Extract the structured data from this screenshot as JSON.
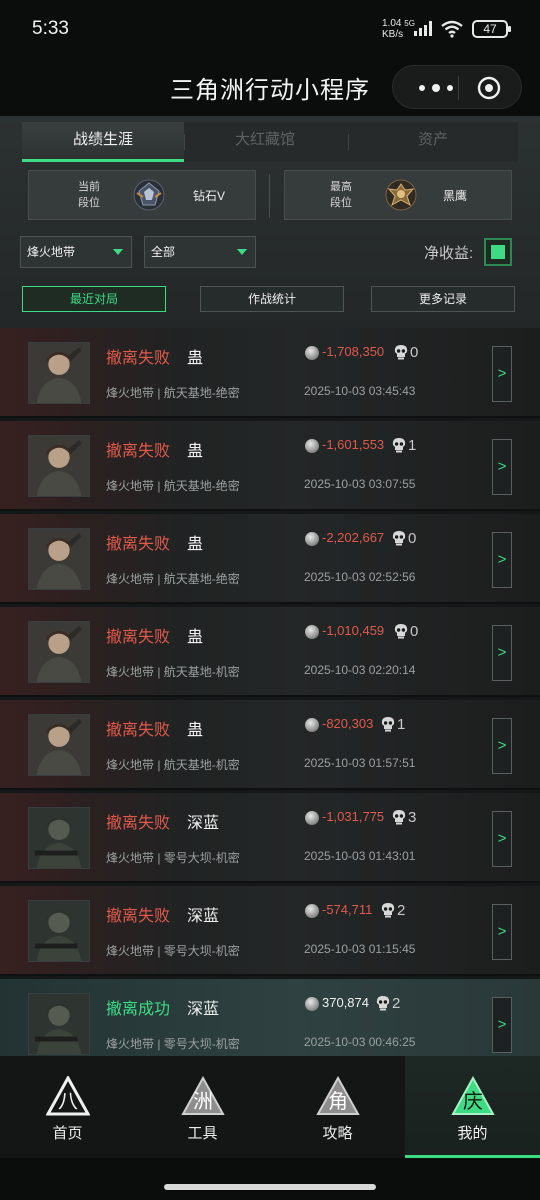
{
  "status_bar": {
    "time": "5:33",
    "net_speed": "1.04",
    "net_unit": "KB/s",
    "network": "5G",
    "battery": "47"
  },
  "app": {
    "title": "三角洲行动小程序"
  },
  "tabs": [
    {
      "label": "战绩生涯",
      "active": true
    },
    {
      "label": "大红藏馆",
      "active": false
    },
    {
      "label": "资产",
      "active": false
    }
  ],
  "rank": {
    "current_label_1": "当前",
    "current_label_2": "段位",
    "current_value": "钻石V",
    "highest_label_1": "最高",
    "highest_label_2": "段位",
    "highest_value": "黑鹰"
  },
  "filters": {
    "mode": "烽火地带",
    "scope": "全部",
    "net_income_label": "净收益:"
  },
  "sub_tabs": [
    {
      "label": "最近对局",
      "active": true
    },
    {
      "label": "作战统计",
      "active": false
    },
    {
      "label": "更多记录",
      "active": false
    }
  ],
  "matches": [
    {
      "status": "撤离失败",
      "outcome": "fail",
      "operator": "蛊",
      "map": "烽火地带 | 航天基地-绝密",
      "value": "-1,708,350",
      "kills": "0",
      "datetime": "2025-10-03 03:45:43",
      "go": ">"
    },
    {
      "status": "撤离失败",
      "outcome": "fail",
      "operator": "蛊",
      "map": "烽火地带 | 航天基地-绝密",
      "value": "-1,601,553",
      "kills": "1",
      "datetime": "2025-10-03 03:07:55",
      "go": ">"
    },
    {
      "status": "撤离失败",
      "outcome": "fail",
      "operator": "蛊",
      "map": "烽火地带 | 航天基地-绝密",
      "value": "-2,202,667",
      "kills": "0",
      "datetime": "2025-10-03 02:52:56",
      "go": ">"
    },
    {
      "status": "撤离失败",
      "outcome": "fail",
      "operator": "蛊",
      "map": "烽火地带 | 航天基地-机密",
      "value": "-1,010,459",
      "kills": "0",
      "datetime": "2025-10-03 02:20:14",
      "go": ">"
    },
    {
      "status": "撤离失败",
      "outcome": "fail",
      "operator": "蛊",
      "map": "烽火地带 | 航天基地-机密",
      "value": "-820,303",
      "kills": "1",
      "datetime": "2025-10-03 01:57:51",
      "go": ">"
    },
    {
      "status": "撤离失败",
      "outcome": "fail",
      "operator": "深蓝",
      "map": "烽火地带 | 零号大坝-机密",
      "value": "-1,031,775",
      "kills": "3",
      "datetime": "2025-10-03 01:43:01",
      "go": ">"
    },
    {
      "status": "撤离失败",
      "outcome": "fail",
      "operator": "深蓝",
      "map": "烽火地带 | 零号大坝-机密",
      "value": "-574,711",
      "kills": "2",
      "datetime": "2025-10-03 01:15:45",
      "go": ">"
    },
    {
      "status": "撤离成功",
      "outcome": "success",
      "operator": "深蓝",
      "map": "烽火地带 | 零号大坝-机密",
      "value": "370,874",
      "kills": "2",
      "datetime": "2025-10-03 00:46:25",
      "go": ">"
    }
  ],
  "bottom_nav": [
    {
      "label": "首页",
      "glyph": "八",
      "active": false
    },
    {
      "label": "工具",
      "glyph": "洲",
      "active": false
    },
    {
      "label": "攻略",
      "glyph": "角",
      "active": false
    },
    {
      "label": "我的",
      "glyph": "庆",
      "active": true
    }
  ],
  "colors": {
    "accent": "#3ddc84",
    "fail": "#e05a4c",
    "background": "#0b0c0c"
  }
}
